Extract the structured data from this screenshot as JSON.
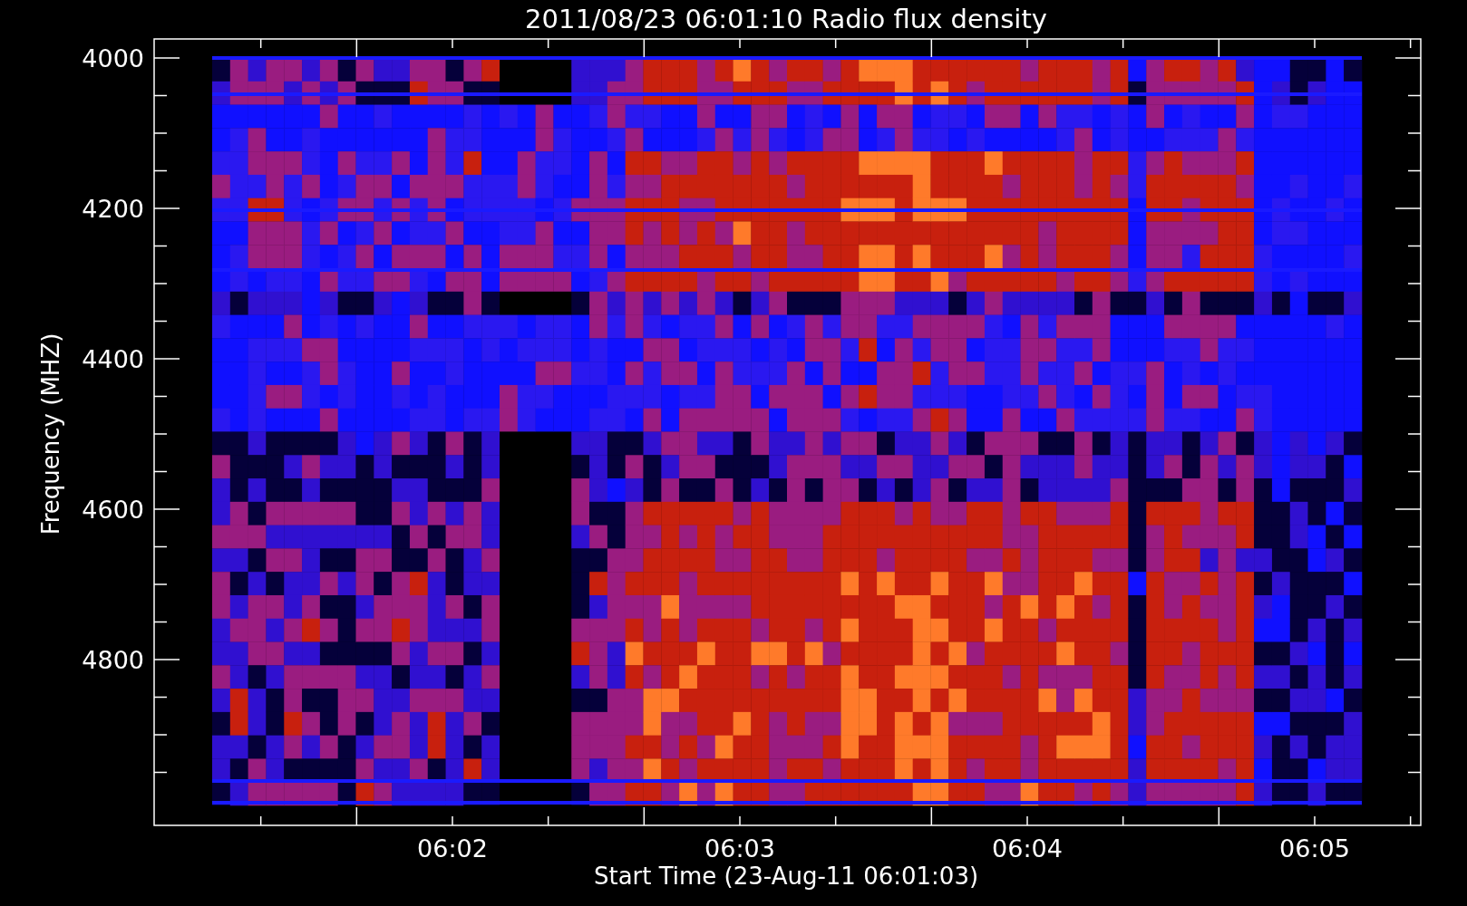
{
  "title": "2011/08/23 06:01:10 Radio flux density",
  "y_axis": {
    "label": "Frequency (MHZ)",
    "tick_labels": [
      "4000",
      "4200",
      "4400",
      "4600",
      "4800"
    ]
  },
  "x_axis": {
    "label": "Start Time (23-Aug-11 06:01:03)",
    "tick_labels": [
      "06:02",
      "06:03",
      "06:04",
      "06:05"
    ]
  }
}
